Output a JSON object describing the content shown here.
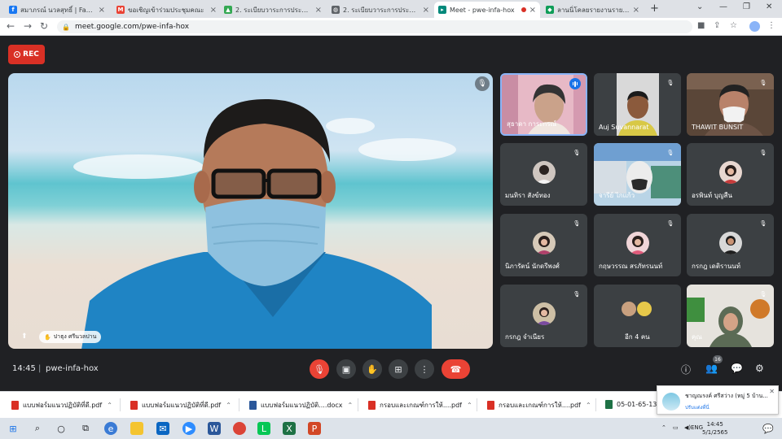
{
  "browser": {
    "tabs": [
      {
        "title": "สมาภรณ์ นวลสุทธิ์ | Facebook",
        "icon": "facebook-icon",
        "color": "#1877f2"
      },
      {
        "title": "ขอเชิญเข้าร่วมประชุมคณะ",
        "icon": "gmail-icon",
        "color": "#ea4335"
      },
      {
        "title": "2. ระเบียบวาระการประชุมคณะ",
        "icon": "drive-icon",
        "color": "#34a853"
      },
      {
        "title": "2. ระเบียบวาระการประชุมคณะ",
        "icon": "globe-icon",
        "color": "#5f6368"
      },
      {
        "title": "Meet - pwe-infa-hox",
        "icon": "meet-icon",
        "color": "#00897b"
      },
      {
        "title": "ลานนิ่โคลยรายงานรายชื่อนักศึก",
        "icon": "site-icon",
        "color": "#0f9d58"
      }
    ],
    "new_tab": "+",
    "url": "meet.google.com/pwe-infa-hox"
  },
  "meet": {
    "rec_label": "REC",
    "presenter_name": "ปาธุง ศรีนวลปาน",
    "participants": [
      {
        "name": "สุธาดา การะกรณ์"
      },
      {
        "name": "Auj Suvannarat"
      },
      {
        "name": "THAWIT BUNSIT"
      },
      {
        "name": "มนทิรา สังข์ทอง"
      },
      {
        "name": "จารีย์ ไกแก้ว"
      },
      {
        "name": "อรพินท์ บุญสืน"
      },
      {
        "name": "นิภารัตน์ นักดรีพงศ์"
      },
      {
        "name": "กฤษวรรณ สรภัทรนนท์"
      },
      {
        "name": "กรกฎ เดติรานนท์"
      },
      {
        "name": "กรกฎ จำเนียร"
      },
      {
        "name": "อีก 4 คน"
      },
      {
        "name": "คุณ"
      }
    ],
    "time": "14:45",
    "separator": "|",
    "meeting_code": "pwe-infa-hox",
    "people_count": "16"
  },
  "downloads": [
    {
      "name": "แบบฟอร์มแนวปฏิบัติที่ดี.pdf",
      "type": "pdf"
    },
    {
      "name": "แบบฟอร์มแนวปฏิบัติที่ดี.pdf",
      "type": "pdf"
    },
    {
      "name": "แบบฟอร์มแนวปฏิบัติ....docx",
      "type": "doc"
    },
    {
      "name": "กรอบและเกณฑ์การให้....pdf",
      "type": "pdf"
    },
    {
      "name": "กรอบและเกณฑ์การให้....pdf",
      "type": "pdf"
    },
    {
      "name": "05-01-65-13-...",
      "type": "xls"
    }
  ],
  "notification": {
    "title": "ชาญณรงค์ ศรีสว่าง (หมู่ 5 บ้าน...",
    "action": "ปรับแต่งที่นี่"
  },
  "taskbar": {
    "language": "ENG",
    "time": "14:45",
    "date": "5/1/2565"
  }
}
